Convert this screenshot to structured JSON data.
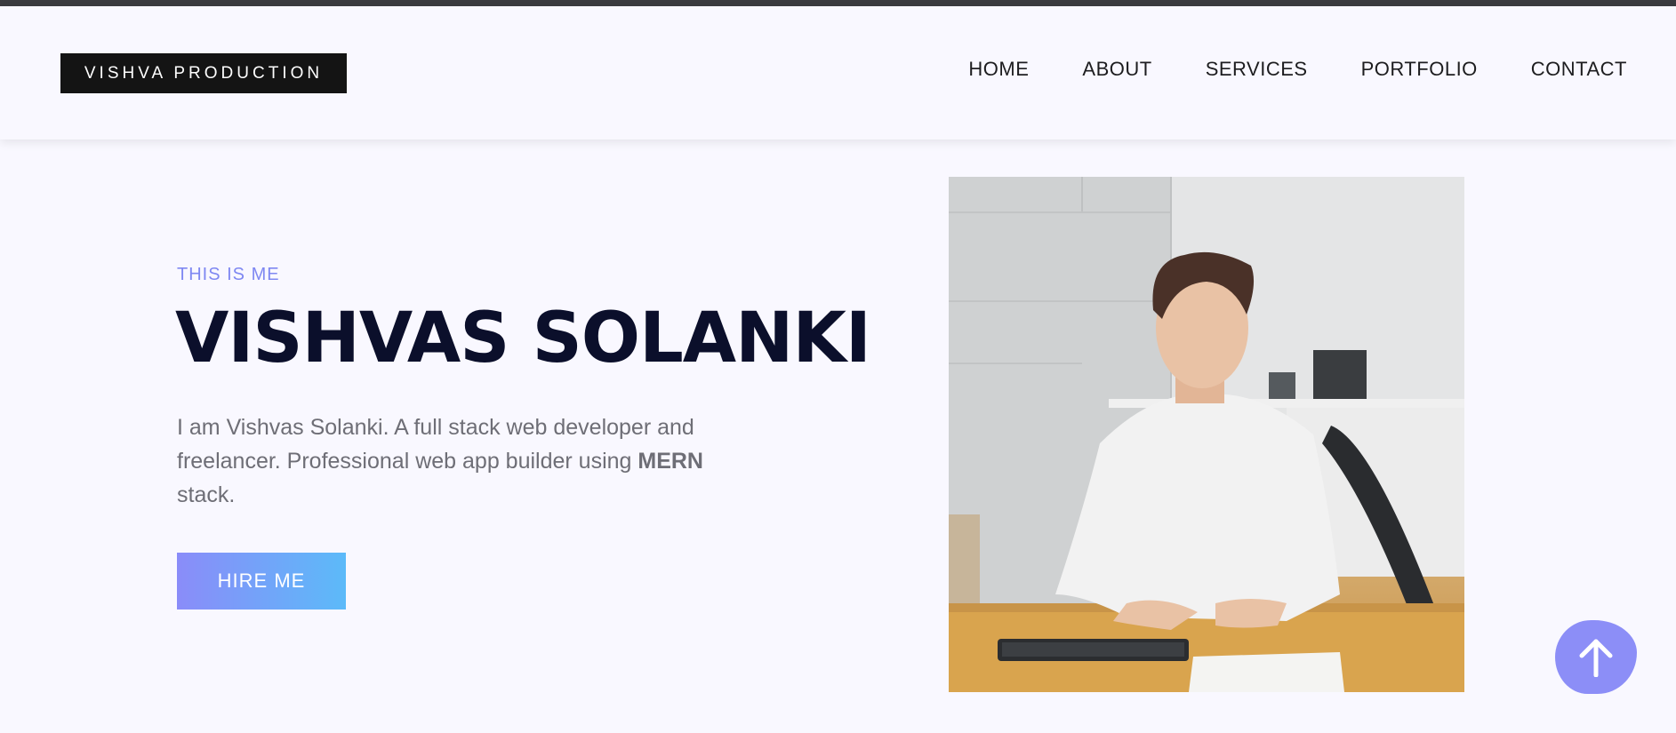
{
  "header": {
    "logo_text": "VISHVA PRODUCTION",
    "nav": [
      {
        "label": "HOME"
      },
      {
        "label": "ABOUT"
      },
      {
        "label": "SERVICES"
      },
      {
        "label": "PORTFOLIO"
      },
      {
        "label": "CONTACT"
      }
    ]
  },
  "hero": {
    "eyebrow": "THIS IS ME",
    "name": "VISHVAS SOLANKI",
    "bio_prefix": "I am Vishvas Solanki. A full stack web developer and freelancer. Professional web app builder using ",
    "bio_bold": "MERN",
    "bio_suffix": " stack.",
    "cta_label": "HIRE ME"
  },
  "colors": {
    "accent": "#7f88f2",
    "heading": "#0b0f2b",
    "background": "#f9f8ff",
    "cta_gradient_start": "#8a8cf9",
    "cta_gradient_end": "#5cbaf9"
  },
  "icons": {
    "scroll_top": "arrow-up-icon"
  }
}
